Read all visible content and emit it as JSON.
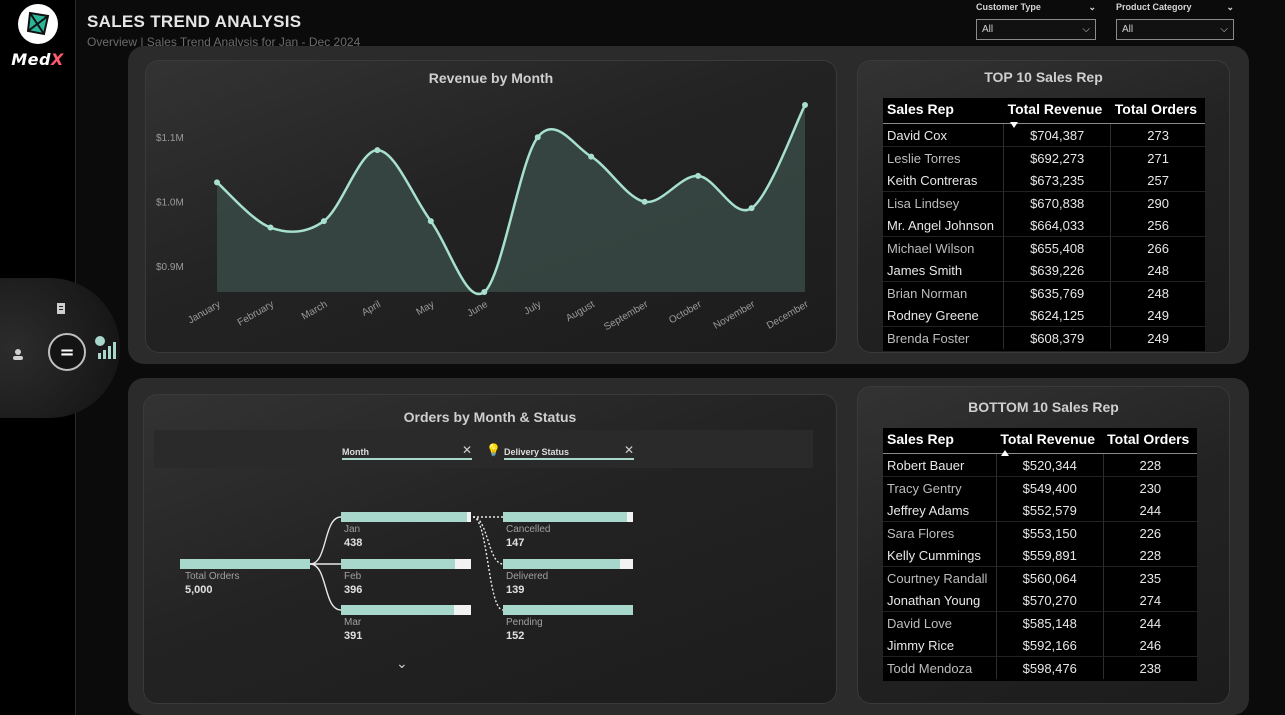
{
  "app": {
    "logo_text_main": "Med",
    "logo_text_accent": "X"
  },
  "header": {
    "title": "SALES TREND ANALYSIS",
    "subtitle": "Overview | Sales Trend Analysis for Jan - Dec 2024"
  },
  "filters": [
    {
      "label": "Customer Type",
      "value": "All"
    },
    {
      "label": "Product Category",
      "value": "All"
    }
  ],
  "nav": {
    "center_symbol": "="
  },
  "revenue_chart": {
    "title": "Revenue by Month",
    "chart_data": {
      "type": "area",
      "categories": [
        "January",
        "February",
        "March",
        "April",
        "May",
        "June",
        "July",
        "August",
        "September",
        "October",
        "November",
        "December"
      ],
      "values": [
        1.03,
        0.96,
        0.97,
        1.08,
        0.97,
        0.86,
        1.1,
        1.07,
        1.0,
        1.04,
        0.99,
        1.15
      ],
      "y_ticks": [
        "$0.9M",
        "$1.0M",
        "$1.1M"
      ],
      "y_tick_values": [
        0.9,
        1.0,
        1.1
      ],
      "ylim": [
        0.86,
        1.15
      ],
      "line_color": "#a8e0d0",
      "fill_color": "#3a4a46"
    }
  },
  "top10": {
    "title": "TOP 10 Sales Rep",
    "columns": [
      "Sales Rep",
      "Total Revenue",
      "Total Orders"
    ],
    "rows": [
      [
        "David Cox",
        "$704,387",
        "273"
      ],
      [
        "Leslie Torres",
        "$692,273",
        "271"
      ],
      [
        "Keith Contreras",
        "$673,235",
        "257"
      ],
      [
        "Lisa Lindsey",
        "$670,838",
        "290"
      ],
      [
        "Mr. Angel Johnson",
        "$664,033",
        "256"
      ],
      [
        "Michael Wilson",
        "$655,408",
        "266"
      ],
      [
        "James Smith",
        "$639,226",
        "248"
      ],
      [
        "Brian Norman",
        "$635,769",
        "248"
      ],
      [
        "Rodney Greene",
        "$624,125",
        "249"
      ],
      [
        "Brenda Foster",
        "$608,379",
        "249"
      ]
    ]
  },
  "bottom10": {
    "title": "BOTTOM 10 Sales Rep",
    "columns": [
      "Sales Rep",
      "Total Revenue",
      "Total Orders"
    ],
    "rows": [
      [
        "Robert Bauer",
        "$520,344",
        "228"
      ],
      [
        "Tracy Gentry",
        "$549,400",
        "230"
      ],
      [
        "Jeffrey Adams",
        "$552,579",
        "244"
      ],
      [
        "Sara Flores",
        "$553,150",
        "226"
      ],
      [
        "Kelly Cummings",
        "$559,891",
        "228"
      ],
      [
        "Courtney Randall",
        "$560,064",
        "235"
      ],
      [
        "Jonathan Young",
        "$570,270",
        "274"
      ],
      [
        "David Love",
        "$585,148",
        "244"
      ],
      [
        "Jimmy Rice",
        "$592,166",
        "246"
      ],
      [
        "Todd Mendoza",
        "$598,476",
        "238"
      ]
    ]
  },
  "orders_tree": {
    "title": "Orders by Month & Status",
    "level1_field": "Month",
    "level2_field": "Delivery Status",
    "root": {
      "label": "Total Orders",
      "value": "5,000"
    },
    "months": [
      {
        "label": "Jan",
        "value": "438",
        "fill": 0.97
      },
      {
        "label": "Feb",
        "value": "396",
        "fill": 0.88
      },
      {
        "label": "Mar",
        "value": "391",
        "fill": 0.87
      }
    ],
    "statuses": [
      {
        "label": "Cancelled",
        "value": "147",
        "fill": 0.95
      },
      {
        "label": "Delivered",
        "value": "139",
        "fill": 0.9
      },
      {
        "label": "Pending",
        "value": "152",
        "fill": 1.0
      }
    ]
  },
  "colors": {
    "accent": "#a8d8cc",
    "brand_accent": "#ff5a6e"
  }
}
